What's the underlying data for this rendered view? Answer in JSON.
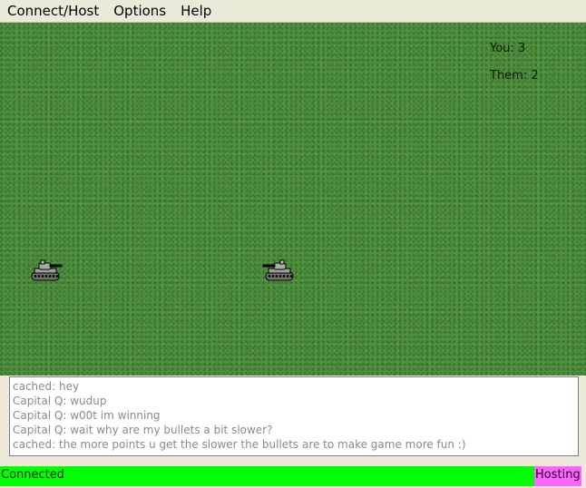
{
  "menu": {
    "items": [
      "Connect/Host",
      "Options",
      "Help"
    ]
  },
  "scoreboard": {
    "you": "You: 3",
    "them": "Them: 2"
  },
  "game": {
    "tanks": [
      {
        "name": "player-tank",
        "icon": "tank-icon"
      },
      {
        "name": "opponent-tank",
        "icon": "tank-icon"
      }
    ]
  },
  "chat": {
    "lines": [
      "cached: hey",
      "Capital Q: wudup",
      "Capital Q: w00t im winning",
      "Capital Q: wait why are my bullets a bit slower?",
      "cached: the more points u get the slower the bullets are to make game more fun :)"
    ]
  },
  "status": {
    "connection": "Connected",
    "mode": "Hosting",
    "connection_color": "#00ff00",
    "mode_color": "#ff66ff"
  }
}
